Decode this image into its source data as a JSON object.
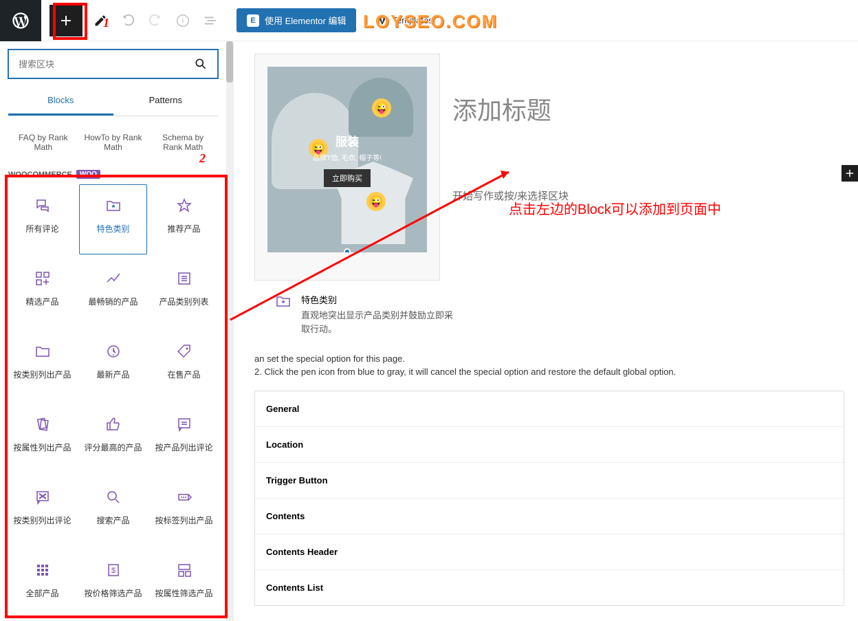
{
  "toolbar": {
    "elementor_label": "使用 Elementor 编辑",
    "templates_label": "Templates"
  },
  "watermark": "LOYSEO.COM",
  "sidebar": {
    "search_placeholder": "搜索区块",
    "tabs": [
      "Blocks",
      "Patterns"
    ],
    "rankmath": [
      "FAQ by Rank Math",
      "HowTo by Rank Math",
      "Schema by Rank Math"
    ],
    "section_title": "WOOCOMMERCE",
    "section_badge": "WOO",
    "blocks": [
      {
        "label": "所有评论",
        "icon": "chat"
      },
      {
        "label": "特色类别",
        "icon": "folder-star",
        "selected": true
      },
      {
        "label": "推荐产品",
        "icon": "star"
      },
      {
        "label": "精选产品",
        "icon": "grid-plus"
      },
      {
        "label": "最畅销的产品",
        "icon": "trend"
      },
      {
        "label": "产品类别列表",
        "icon": "list"
      },
      {
        "label": "按类别列出产品",
        "icon": "folder"
      },
      {
        "label": "最新产品",
        "icon": "new"
      },
      {
        "label": "在售产品",
        "icon": "tag"
      },
      {
        "label": "按属性列出产品",
        "icon": "cards"
      },
      {
        "label": "评分最高的产品",
        "icon": "thumb"
      },
      {
        "label": "按产品列出评论",
        "icon": "comment"
      },
      {
        "label": "按类别列出评论",
        "icon": "review"
      },
      {
        "label": "搜索产品",
        "icon": "search"
      },
      {
        "label": "按标签列出产品",
        "icon": "tag-more"
      },
      {
        "label": "全部产品",
        "icon": "grid9"
      },
      {
        "label": "按价格筛选产品",
        "icon": "price"
      },
      {
        "label": "按属性筛选产品",
        "icon": "filter"
      }
    ]
  },
  "editor": {
    "preview": {
      "title": "服装",
      "subtitle": "品牌T恤, 毛衣, 帽子等!",
      "button": "立即购买"
    },
    "page_title": "添加标题",
    "hint": "开始写作或按/来选择区块",
    "desc_title": "特色类别",
    "desc_body": "直观地突出显示产品类别并鼓励立即采取行动。",
    "instruction1": "an set the special option for this page.",
    "instruction2": "2. Click the pen icon from blue to gray, it will cancel the special option and restore the default global option.",
    "accordion": [
      "General",
      "Location",
      "Trigger Button",
      "Contents",
      "Contents Header",
      "Contents List"
    ]
  },
  "annotations": {
    "num1": "1",
    "num2": "2",
    "text": "点击左边的Block可以添加到页面中"
  }
}
